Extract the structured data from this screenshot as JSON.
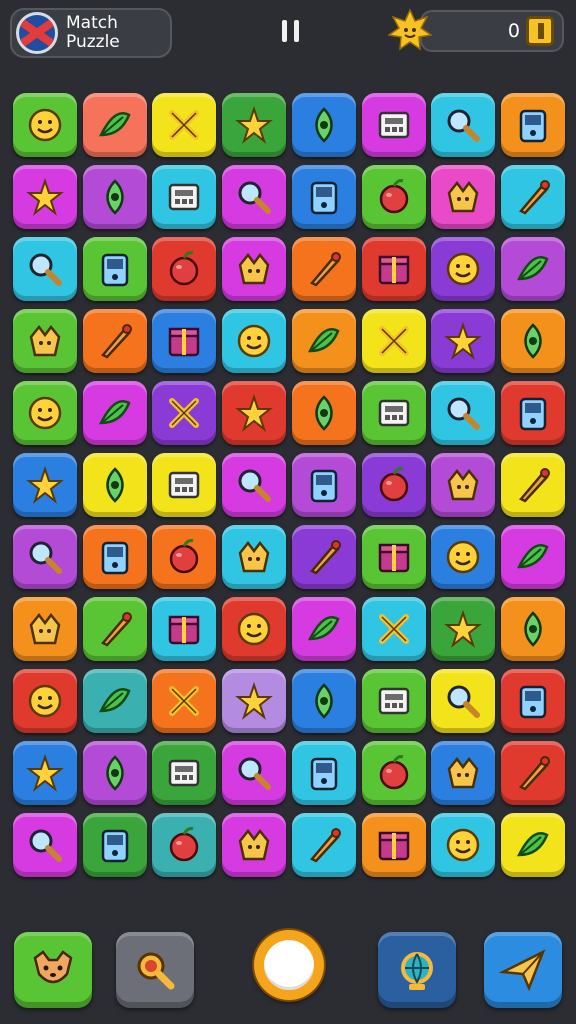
{
  "header": {
    "title_line1": "Match",
    "title_line2": "Puzzle",
    "flag_icon": "uk-flag-icon",
    "pause_icon": "pause-icon",
    "score_icon": "sun-star-icon",
    "score": "0",
    "coin_icon": "coin-icon"
  },
  "board": {
    "rows": 11,
    "cols": 8,
    "tiles": [
      [
        {
          "color": "#5ac534",
          "icon": "cash-register-icon"
        },
        {
          "color": "#f4735a",
          "icon": "cherry-ball-icon"
        },
        {
          "color": "#f2e31a",
          "icon": "jar-icon"
        },
        {
          "color": "#3aa53a",
          "icon": "pencil-icon"
        },
        {
          "color": "#2b7fe0",
          "icon": "ruler-icon"
        },
        {
          "color": "#d53be0",
          "icon": "leaf-feather-icon"
        },
        {
          "color": "#30c6e3",
          "icon": "calculator-icon"
        },
        {
          "color": "#f4901c",
          "icon": "cake-slice-icon"
        }
      ],
      [
        {
          "color": "#d53be0",
          "icon": "money-stack-icon"
        },
        {
          "color": "#b34bd6",
          "icon": "snowflake-flower-icon"
        },
        {
          "color": "#30c6e3",
          "icon": "popsicle-icon"
        },
        {
          "color": "#d53be0",
          "icon": "shovel-icon"
        },
        {
          "color": "#2b7fe0",
          "icon": "acorn-icon"
        },
        {
          "color": "#5ac534",
          "icon": "chili-pepper-icon"
        },
        {
          "color": "#e84ac8",
          "icon": "donut-icon"
        },
        {
          "color": "#30c6e3",
          "icon": "lollipop-icon"
        }
      ],
      [
        {
          "color": "#30c6e3",
          "icon": "cookie-face-icon"
        },
        {
          "color": "#5ac534",
          "icon": "smiley-face-icon"
        },
        {
          "color": "#e03a2e",
          "icon": "boy-face-icon"
        },
        {
          "color": "#d53be0",
          "icon": "bottle-icon"
        },
        {
          "color": "#f4731c",
          "icon": "sun-face-icon"
        },
        {
          "color": "#e03a2e",
          "icon": "blue-splat-icon"
        },
        {
          "color": "#8a3bd6",
          "icon": "umbrella-icon"
        },
        {
          "color": "#b34bd6",
          "icon": "lemon-icon"
        }
      ],
      [
        {
          "color": "#5ac534",
          "icon": "gear-flower-icon"
        },
        {
          "color": "#f4731c",
          "icon": "window-icon"
        },
        {
          "color": "#2b7fe0",
          "icon": "basket-icon"
        },
        {
          "color": "#30c6e3",
          "icon": "bulb-icon"
        },
        {
          "color": "#f4901c",
          "icon": "brush-icon"
        },
        {
          "color": "#f2e31a",
          "icon": "hammer-icon"
        },
        {
          "color": "#8a3bd6",
          "icon": "magnifier-icon"
        },
        {
          "color": "#f4901c",
          "icon": "screwdriver-icon"
        }
      ],
      [
        {
          "color": "#5ac534",
          "icon": "grid-panel-icon"
        },
        {
          "color": "#d53be0",
          "icon": "dice-icon"
        },
        {
          "color": "#8a3bd6",
          "icon": "map-pin-icon"
        },
        {
          "color": "#e03a2e",
          "icon": "yellow-monster-icon"
        },
        {
          "color": "#f4731c",
          "icon": "key-loop-icon"
        },
        {
          "color": "#5ac534",
          "icon": "cookie-smile-icon"
        },
        {
          "color": "#30c6e3",
          "icon": "gourd-icon"
        },
        {
          "color": "#e03a2e",
          "icon": "star-icon"
        }
      ],
      [
        {
          "color": "#2b7fe0",
          "icon": "cat-face-icon"
        },
        {
          "color": "#f2e31a",
          "icon": "ring-gear-icon"
        },
        {
          "color": "#f2e31a",
          "icon": "gift-box-icon"
        },
        {
          "color": "#d53be0",
          "icon": "cat-head-icon"
        },
        {
          "color": "#b34bd6",
          "icon": "cross-swords-icon"
        },
        {
          "color": "#8a3bd6",
          "icon": "onion-icon"
        },
        {
          "color": "#b34bd6",
          "icon": "swirl-icon"
        },
        {
          "color": "#f2e31a",
          "icon": "kid-face-icon"
        }
      ],
      [
        {
          "color": "#b34bd6",
          "icon": "crossbow-icon"
        },
        {
          "color": "#f4731c",
          "icon": "quill-icon"
        },
        {
          "color": "#f4731c",
          "icon": "taco-icon"
        },
        {
          "color": "#30c6e3",
          "icon": "sunburst-icon"
        },
        {
          "color": "#8a3bd6",
          "icon": "yellow-x-icon"
        },
        {
          "color": "#5ac534",
          "icon": "witch-hat-icon"
        },
        {
          "color": "#2b7fe0",
          "icon": "scissors-icon"
        },
        {
          "color": "#d53be0",
          "icon": "paper-roll-icon"
        }
      ],
      [
        {
          "color": "#f4901c",
          "icon": "trowel-icon"
        },
        {
          "color": "#5ac534",
          "icon": "compass-wheel-icon"
        },
        {
          "color": "#30c6e3",
          "icon": "crossed-sticks-icon"
        },
        {
          "color": "#e03a2e",
          "icon": "flashlight-icon"
        },
        {
          "color": "#d53be0",
          "icon": "blue-potion-icon"
        },
        {
          "color": "#30c6e3",
          "icon": "pink-flask-icon"
        },
        {
          "color": "#3aa53a",
          "icon": "coconut-icon"
        },
        {
          "color": "#f4901c",
          "icon": "notice-board-icon"
        }
      ],
      [
        {
          "color": "#e03a2e",
          "icon": "green-leaf-icon"
        },
        {
          "color": "#3ab0b0",
          "icon": "smile-ball-icon"
        },
        {
          "color": "#f4731c",
          "icon": "orange-leaf-icon"
        },
        {
          "color": "#b38be0",
          "icon": "solar-panel-icon"
        },
        {
          "color": "#2b7fe0",
          "icon": "baby-face-icon"
        },
        {
          "color": "#5ac534",
          "icon": "tree-icon"
        },
        {
          "color": "#f2e31a",
          "icon": "arrowhead-icon"
        },
        {
          "color": "#e03a2e",
          "icon": "bear-face-icon"
        }
      ],
      [
        {
          "color": "#2b7fe0",
          "icon": "banana-icon"
        },
        {
          "color": "#b34bd6",
          "icon": "rolling-pin-icon"
        },
        {
          "color": "#3aa53a",
          "icon": "lantern-icon"
        },
        {
          "color": "#d53be0",
          "icon": "torch-icon"
        },
        {
          "color": "#30c6e3",
          "icon": "smiley-coin-icon"
        },
        {
          "color": "#5ac534",
          "icon": "cat-smile-icon"
        },
        {
          "color": "#2b7fe0",
          "icon": "oven-icon"
        },
        {
          "color": "#e03a2e",
          "icon": "ghost-icon"
        }
      ],
      [
        {
          "color": "#d53be0",
          "icon": "eyes-icon"
        },
        {
          "color": "#3aa53a",
          "icon": "potato-face-icon"
        },
        {
          "color": "#3ab0b0",
          "icon": "red-bird-icon"
        },
        {
          "color": "#d53be0",
          "icon": "gold-coin-icon"
        },
        {
          "color": "#30c6e3",
          "icon": "red-feather-icon"
        },
        {
          "color": "#f4901c",
          "icon": "paint-tube-icon"
        },
        {
          "color": "#30c6e3",
          "icon": "gold-gear-icon"
        },
        {
          "color": "#f2e31a",
          "icon": "grandma-face-icon"
        }
      ]
    ]
  },
  "bottom_bar": [
    {
      "name": "character-button",
      "color": "#5ac534",
      "icon": "fox-face-icon"
    },
    {
      "name": "search-hint-button",
      "color": "#6c6f77",
      "icon": "magnifier-key-icon"
    },
    {
      "name": "globe-button",
      "color": "#2a5fa0",
      "icon": "globe-icon"
    },
    {
      "name": "play-button",
      "color": "#2b8ce0",
      "icon": "paper-plane-icon"
    }
  ]
}
